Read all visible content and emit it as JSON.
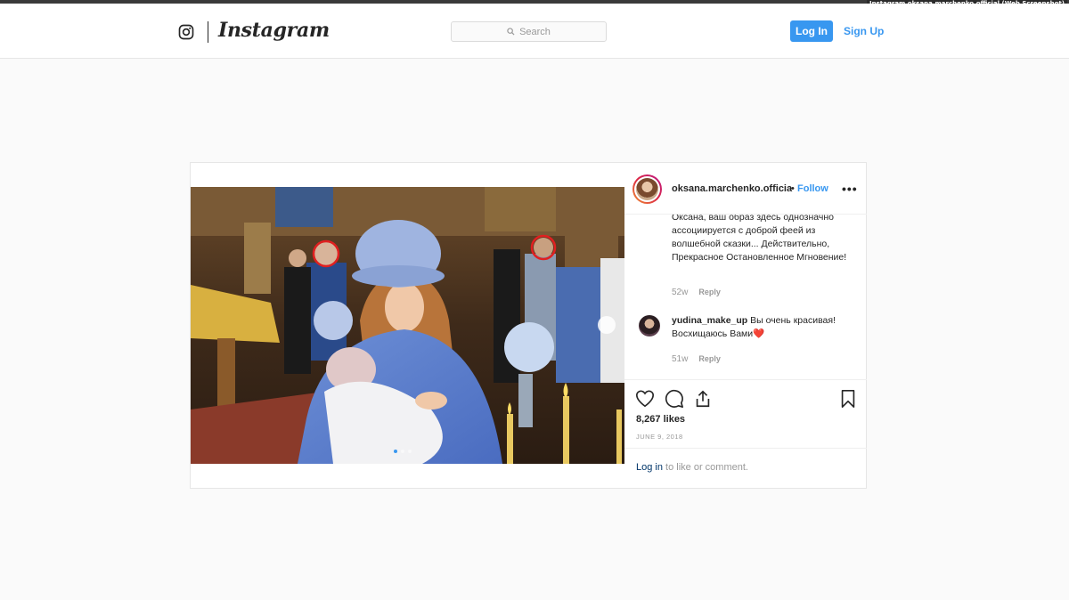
{
  "overlay_caption": "Instagram oksana.marchenko.official (Web Screenshot)",
  "nav": {
    "logo_icon": "instagram-camera-icon",
    "wordmark": "Instagram",
    "search_placeholder": "Search",
    "search_icon": "search-icon",
    "login_label": "Log In",
    "signup_label": "Sign Up"
  },
  "post": {
    "username": "oksana.marchenko.officia",
    "bullet": "•",
    "follow_label": "Follow",
    "more_icon": "•••",
    "image_carousel": {
      "current": 1,
      "total": 3
    },
    "comments": [
      {
        "user": "",
        "text": "Оксана, ваш образ здесь однозначно ассоциируется с доброй феей из волшебной сказки... Действительно, Прекрасное Остановленное Мгновение!",
        "age": "52w",
        "reply": "Reply"
      },
      {
        "user": "yudina_make_up",
        "text": "Вы очень красивая! Восхищаюсь Вами❤️",
        "age": "51w",
        "reply": "Reply"
      }
    ],
    "likes": "8,267 likes",
    "date": "JUNE 9, 2018",
    "login_prompt_link": "Log in",
    "login_prompt_rest": " to like or comment."
  },
  "colors": {
    "accent": "#3897f0",
    "background": "#fafafa",
    "border": "#e6e6e6",
    "text": "#262626",
    "muted": "#999999"
  }
}
